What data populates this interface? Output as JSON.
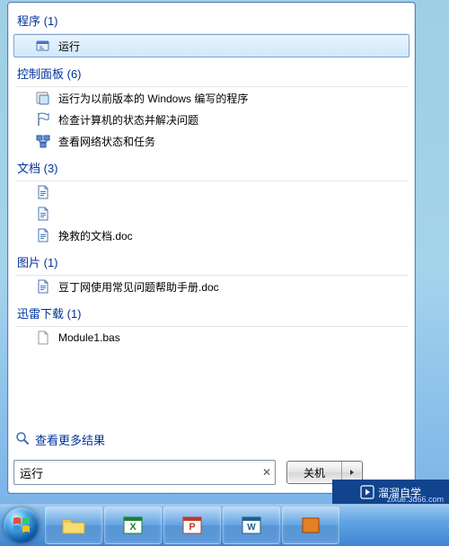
{
  "groups": [
    {
      "header": "程序 (1)",
      "items": [
        {
          "label": "运行",
          "icon": "run",
          "selected": true
        }
      ]
    },
    {
      "header": "控制面板 (6)",
      "items": [
        {
          "label": "运行为以前版本的 Windows 编写的程序",
          "icon": "compat"
        },
        {
          "label": "检查计算机的状态并解决问题",
          "icon": "flag"
        },
        {
          "label": "查看网络状态和任务",
          "icon": "network"
        }
      ]
    },
    {
      "header": "文档 (3)",
      "items": [
        {
          "label": "",
          "icon": "doc"
        },
        {
          "label": "",
          "icon": "doc"
        },
        {
          "label": "挽救的文档.doc",
          "icon": "doc"
        }
      ]
    },
    {
      "header": "图片 (1)",
      "items": [
        {
          "label": "豆丁网使用常见问题帮助手册.doc",
          "icon": "doc"
        }
      ]
    },
    {
      "header": "迅雷下载 (1)",
      "items": [
        {
          "label": "Module1.bas",
          "icon": "file"
        }
      ]
    }
  ],
  "see_more": "查看更多结果",
  "search": {
    "value": "运行"
  },
  "shutdown": {
    "label": "关机"
  },
  "watermark": {
    "brand": "溜溜自学",
    "url": "zixue.3d66.com"
  },
  "taskbar_apps": [
    "explorer",
    "excel",
    "powerpoint",
    "word",
    "other"
  ]
}
